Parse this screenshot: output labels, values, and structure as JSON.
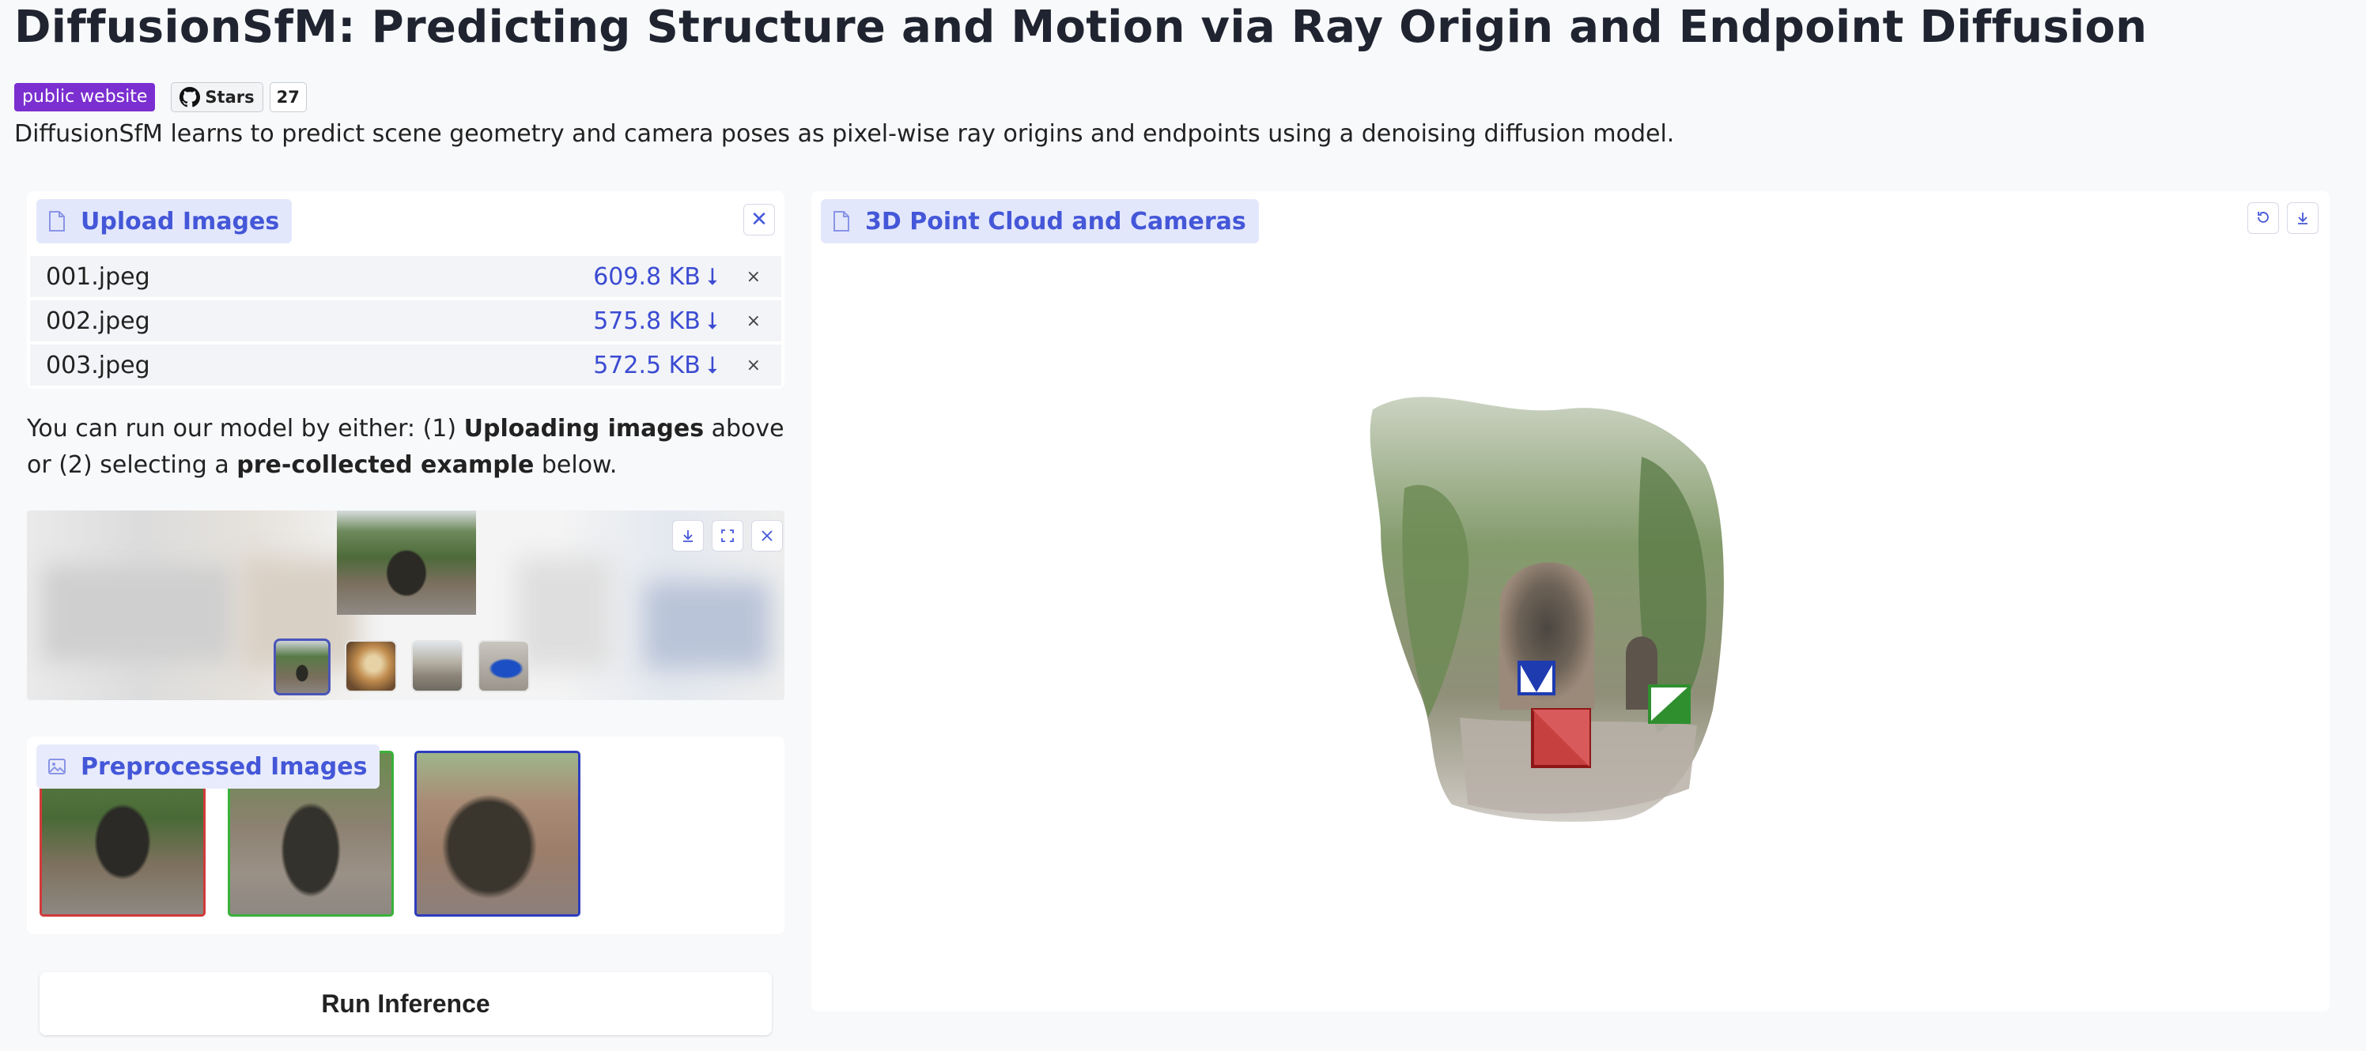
{
  "header": {
    "title": "DiffusionSfM: Predicting Structure and Motion via Ray Origin and Endpoint Diffusion",
    "badge_site": "public website",
    "github_stars_label": "Stars",
    "github_stars_count": "27",
    "subtitle": "DiffusionSfM learns to predict scene geometry and camera poses as pixel-wise ray origins and endpoints using a denoising diffusion model."
  },
  "upload": {
    "label": "Upload Images",
    "files": [
      {
        "name": "001.jpeg",
        "size": "609.8 KB"
      },
      {
        "name": "002.jpeg",
        "size": "575.8 KB"
      },
      {
        "name": "003.jpeg",
        "size": "572.5 KB"
      }
    ],
    "remove_glyph": "×"
  },
  "hint": {
    "part1": "You can run our model by either: (1) ",
    "bold1": "Uploading images",
    "part2": " above or (2) selecting a ",
    "bold2": "pre-collected example",
    "part3": " below."
  },
  "gallery": {
    "icons": [
      "download-icon",
      "fullscreen-icon",
      "close-icon"
    ],
    "thumbnails": 4,
    "selected_index": 0
  },
  "preprocessed": {
    "label": "Preprocessed Images",
    "frame_colors": [
      "#d23a3a",
      "#39b23a",
      "#2e3dbd"
    ]
  },
  "run": {
    "label": "Run Inference"
  },
  "viewer": {
    "label": "3D Point Cloud and Cameras",
    "icons": [
      "reset-icon",
      "download-icon"
    ],
    "camera_colors": [
      "#1e3bb0",
      "#b11f1f",
      "#2f8f2f"
    ]
  },
  "colors": {
    "accent": "#4457d8",
    "tag_bg": "#e3e7fb",
    "badge": "#7b2fd0"
  }
}
